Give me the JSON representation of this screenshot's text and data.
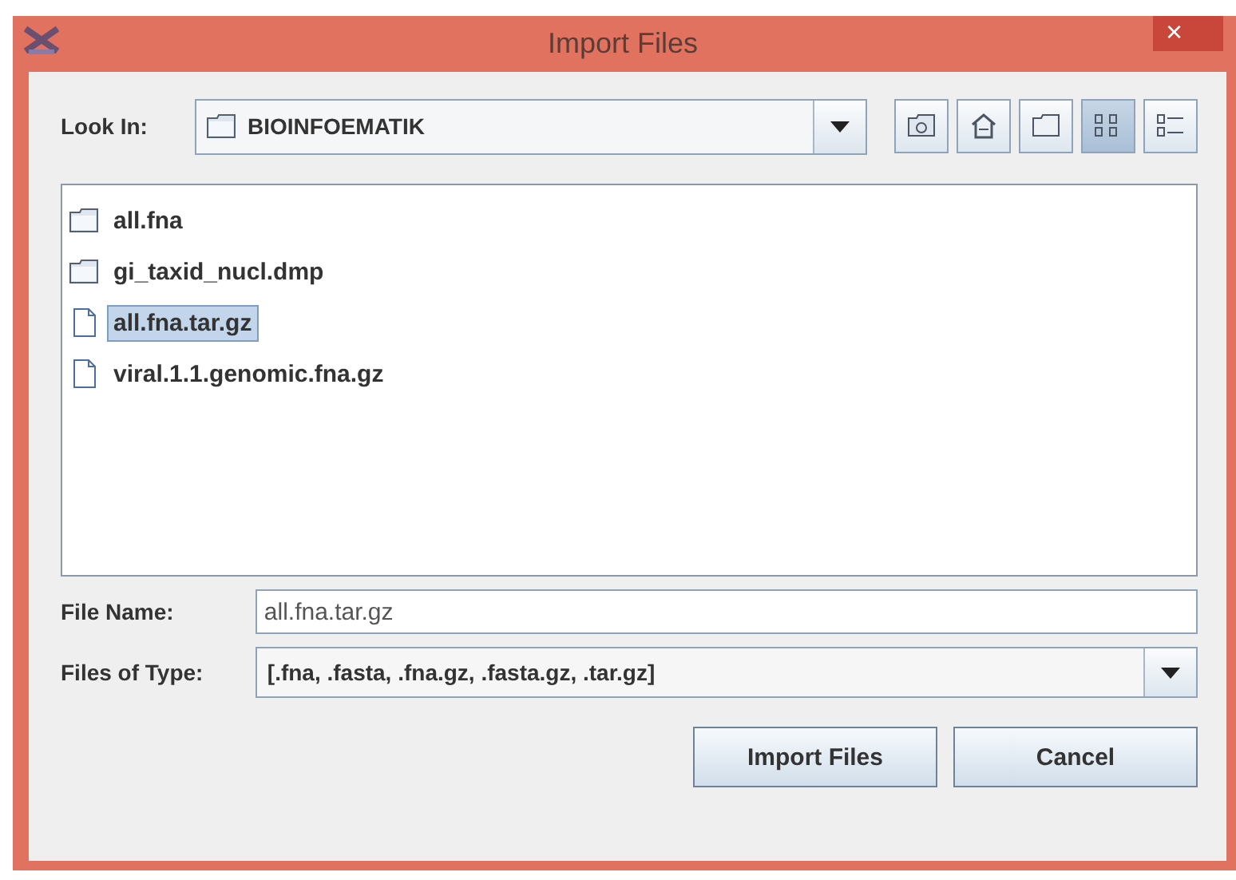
{
  "window": {
    "title": "Import Files",
    "close": "×"
  },
  "look_in": {
    "label": "Look In:",
    "value": "BIOINFOEMATIK"
  },
  "toolbar": [
    {
      "kind": "up",
      "selected": false
    },
    {
      "kind": "home",
      "selected": false
    },
    {
      "kind": "new-folder",
      "selected": false
    },
    {
      "kind": "list",
      "selected": true
    },
    {
      "kind": "details",
      "selected": false
    }
  ],
  "files": [
    {
      "name": "all.fna",
      "kind": "folder",
      "selected": false
    },
    {
      "name": "gi_taxid_nucl.dmp",
      "kind": "folder",
      "selected": false
    },
    {
      "name": "all.fna.tar.gz",
      "kind": "file",
      "selected": true
    },
    {
      "name": "viral.1.1.genomic.fna.gz",
      "kind": "file",
      "selected": false
    }
  ],
  "file_name": {
    "label": "File Name:",
    "value": "all.fna.tar.gz"
  },
  "file_type": {
    "label": "Files of Type:",
    "value": "[.fna, .fasta, .fna.gz, .fasta.gz, .tar.gz]"
  },
  "buttons": [
    "Import Files",
    "Cancel"
  ]
}
